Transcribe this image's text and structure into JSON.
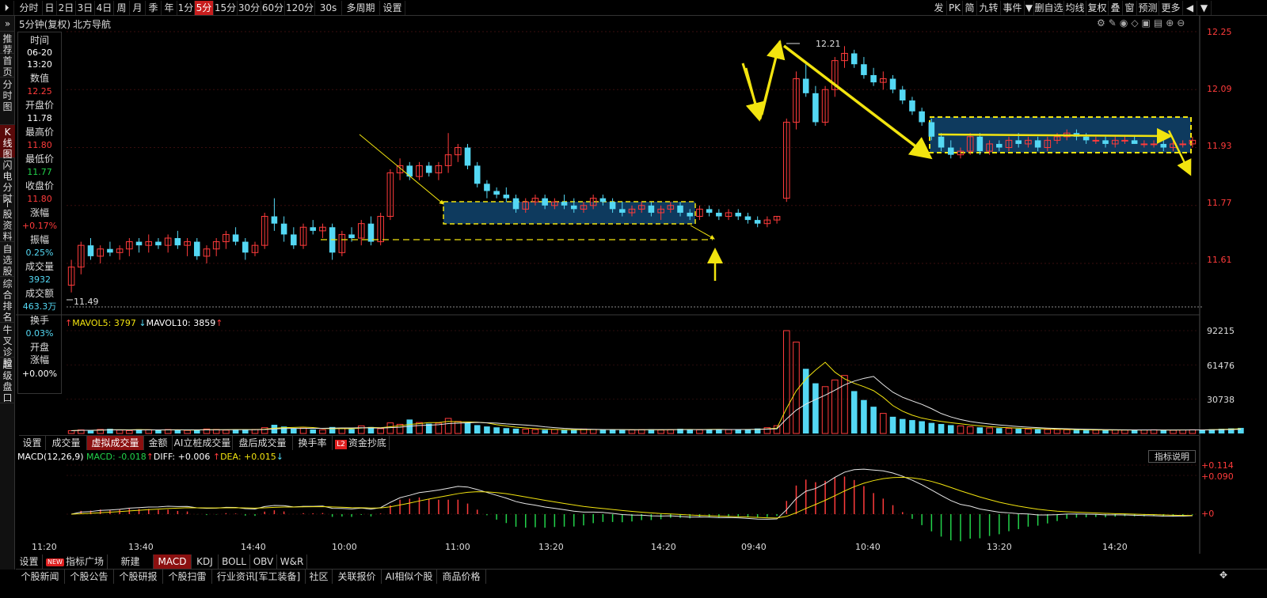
{
  "toolbar": {
    "left": [
      "分时",
      "日",
      "2日",
      "3日",
      "4日",
      "周",
      "月",
      "季",
      "年",
      "1分",
      "5分",
      "15分",
      "30分",
      "60分",
      "120分",
      "30s",
      "多周期",
      "设置"
    ],
    "active": "5分",
    "right": [
      "发",
      "PK",
      "简",
      "九转",
      "事件",
      "▼",
      "删自选",
      "均线",
      "复权",
      "叠",
      "窗",
      "预测",
      "更多",
      "◀",
      "▼"
    ]
  },
  "leftnav": [
    "推荐",
    "首页",
    "分时图",
    "K线图",
    "闪电分时",
    "个股资料",
    "自选股",
    "综合排名",
    "牛叉诊股",
    "超级盘口"
  ],
  "chart_title": "5分钟(复权)",
  "stock_name": "北方导航",
  "info": {
    "time_label": "时间",
    "date": "06-20",
    "time": "13:20",
    "value_label": "数值",
    "value": "12.25",
    "open_label": "开盘价",
    "open": "11.78",
    "high_label": "最高价",
    "high": "11.80",
    "low_label": "最低价",
    "low": "11.77",
    "close_label": "收盘价",
    "close": "11.80",
    "change_label": "涨幅",
    "change": "+0.17%",
    "amplitude_label": "振幅",
    "amplitude": "0.25%",
    "volume_label": "成交量",
    "volume": "3932",
    "amount_label": "成交额",
    "amount": "463.3万",
    "turnover_label": "换手",
    "turnover": "0.03%",
    "open_change_label": "开盘\n涨幅",
    "open_change": "+0.00%"
  },
  "price_axis": [
    "12.25",
    "12.09",
    "11.93",
    "11.77",
    "11.61"
  ],
  "price_marks": {
    "high": "12.21",
    "low": "11.49"
  },
  "volume_axis": [
    "92215",
    "61476",
    "30738"
  ],
  "vol_legend": {
    "mavol5_label": "MAVOL5: ",
    "mavol5": "3797",
    "mavol10_label": "MAVOL10: ",
    "mavol10": "3859"
  },
  "vol_tabs": [
    "设置",
    "成交量",
    "虚拟成交量",
    "金额",
    "AI立桩成交量",
    "盘后成交量",
    "换手率",
    "资金抄底"
  ],
  "vol_tab_active": "虚拟成交量",
  "l2_badge": "L2",
  "macd_legend": {
    "title": "MACD(12,26,9)",
    "macd_label": "MACD: ",
    "macd": "-0.018",
    "diff_label": "DIFF: ",
    "diff": "+0.006",
    "dea_label": "DEA: ",
    "dea": "+0.015"
  },
  "macd_axis": [
    "+0.114",
    "+0.090",
    "+0"
  ],
  "indicator_button": "指标说明",
  "time_axis": [
    "11:20",
    "13:40",
    "14:40",
    "10:00",
    "11:00",
    "13:20",
    "14:20",
    "09:40",
    "10:40",
    "13:20",
    "14:20"
  ],
  "indicator_tabs": [
    "设置",
    "指标广场",
    "新建",
    "MACD",
    "KDJ",
    "BOLL",
    "OBV",
    "W&R"
  ],
  "indicator_tab_active": "MACD",
  "new_badge": "NEW",
  "bottom_tabs": [
    "个股新闻",
    "个股公告",
    "个股研报",
    "个股扫雷",
    "行业资讯[军工装备]",
    "社区",
    "关联报价",
    "AI相似个股",
    "商品价格"
  ],
  "colors": {
    "up": "#ff3b3b",
    "down": "#54d8f4",
    "accent": "#f2e40f",
    "box": "#0e3a5e"
  },
  "chart_data": [
    {
      "type": "candlestick",
      "title": "5分钟(复权) 北方导航",
      "ylim": [
        11.49,
        12.25
      ],
      "y_ticks": [
        12.25,
        12.09,
        11.93,
        11.77,
        11.61
      ],
      "x_ticks": [
        "11:20",
        "13:40",
        "14:40",
        "10:00",
        "11:00",
        "13:20",
        "14:20",
        "09:40",
        "10:40",
        "13:20",
        "14:20"
      ],
      "ohlc": [
        [
          11.55,
          11.62,
          11.53,
          11.6
        ],
        [
          11.6,
          11.67,
          11.58,
          11.66
        ],
        [
          11.66,
          11.68,
          11.62,
          11.63
        ],
        [
          11.63,
          11.66,
          11.61,
          11.65
        ],
        [
          11.65,
          11.67,
          11.63,
          11.64
        ],
        [
          11.64,
          11.66,
          11.62,
          11.65
        ],
        [
          11.65,
          11.68,
          11.63,
          11.67
        ],
        [
          11.67,
          11.68,
          11.64,
          11.66
        ],
        [
          11.66,
          11.69,
          11.64,
          11.67
        ],
        [
          11.67,
          11.68,
          11.65,
          11.66
        ],
        [
          11.66,
          11.69,
          11.64,
          11.68
        ],
        [
          11.68,
          11.7,
          11.65,
          11.66
        ],
        [
          11.66,
          11.68,
          11.63,
          11.67
        ],
        [
          11.67,
          11.68,
          11.62,
          11.63
        ],
        [
          11.63,
          11.66,
          11.61,
          11.65
        ],
        [
          11.65,
          11.68,
          11.63,
          11.67
        ],
        [
          11.67,
          11.7,
          11.65,
          11.69
        ],
        [
          11.69,
          11.71,
          11.66,
          11.67
        ],
        [
          11.67,
          11.68,
          11.62,
          11.64
        ],
        [
          11.64,
          11.67,
          11.63,
          11.66
        ],
        [
          11.66,
          11.75,
          11.65,
          11.74
        ],
        [
          11.74,
          11.79,
          11.7,
          11.72
        ],
        [
          11.72,
          11.74,
          11.67,
          11.69
        ],
        [
          11.69,
          11.71,
          11.65,
          11.66
        ],
        [
          11.66,
          11.72,
          11.65,
          11.71
        ],
        [
          11.71,
          11.73,
          11.69,
          11.7
        ],
        [
          11.7,
          11.72,
          11.68,
          11.71
        ],
        [
          11.71,
          11.72,
          11.62,
          11.64
        ],
        [
          11.64,
          11.7,
          11.63,
          11.69
        ],
        [
          11.69,
          11.71,
          11.67,
          11.68
        ],
        [
          11.68,
          11.73,
          11.66,
          11.72
        ],
        [
          11.72,
          11.74,
          11.66,
          11.67
        ],
        [
          11.67,
          11.75,
          11.66,
          11.74
        ],
        [
          11.74,
          11.87,
          11.73,
          11.86
        ],
        [
          11.86,
          11.9,
          11.84,
          11.88
        ],
        [
          11.88,
          11.89,
          11.84,
          11.85
        ],
        [
          11.85,
          11.89,
          11.84,
          11.88
        ],
        [
          11.88,
          11.89,
          11.85,
          11.86
        ],
        [
          11.86,
          11.89,
          11.84,
          11.88
        ],
        [
          11.88,
          11.97,
          11.86,
          11.91
        ],
        [
          11.91,
          11.94,
          11.89,
          11.93
        ],
        [
          11.93,
          11.94,
          11.87,
          11.88
        ],
        [
          11.88,
          11.89,
          11.82,
          11.83
        ],
        [
          11.83,
          11.84,
          11.79,
          11.81
        ],
        [
          11.81,
          11.82,
          11.79,
          11.8
        ],
        [
          11.8,
          11.82,
          11.78,
          11.79
        ],
        [
          11.79,
          11.8,
          11.75,
          11.76
        ],
        [
          11.76,
          11.79,
          11.75,
          11.78
        ],
        [
          11.78,
          11.8,
          11.77,
          11.79
        ],
        [
          11.79,
          11.8,
          11.76,
          11.77
        ],
        [
          11.77,
          11.79,
          11.76,
          11.78
        ],
        [
          11.78,
          11.8,
          11.76,
          11.77
        ],
        [
          11.77,
          11.79,
          11.75,
          11.76
        ],
        [
          11.76,
          11.78,
          11.75,
          11.77
        ],
        [
          11.77,
          11.8,
          11.76,
          11.79
        ],
        [
          11.79,
          11.8,
          11.77,
          11.78
        ],
        [
          11.78,
          11.79,
          11.75,
          11.76
        ],
        [
          11.76,
          11.78,
          11.74,
          11.75
        ],
        [
          11.75,
          11.77,
          11.74,
          11.76
        ],
        [
          11.76,
          11.78,
          11.75,
          11.77
        ],
        [
          11.77,
          11.78,
          11.74,
          11.75
        ],
        [
          11.75,
          11.77,
          11.73,
          11.76
        ],
        [
          11.76,
          11.78,
          11.75,
          11.77
        ],
        [
          11.77,
          11.78,
          11.74,
          11.75
        ],
        [
          11.75,
          11.76,
          11.73,
          11.74
        ],
        [
          11.74,
          11.77,
          11.73,
          11.76
        ],
        [
          11.76,
          11.77,
          11.74,
          11.75
        ],
        [
          11.75,
          11.76,
          11.73,
          11.74
        ],
        [
          11.74,
          11.76,
          11.73,
          11.75
        ],
        [
          11.75,
          11.76,
          11.73,
          11.74
        ],
        [
          11.74,
          11.75,
          11.72,
          11.73
        ],
        [
          11.73,
          11.74,
          11.71,
          11.72
        ],
        [
          11.72,
          11.74,
          11.71,
          11.73
        ],
        [
          11.73,
          11.74,
          11.72,
          11.74
        ],
        [
          11.79,
          12.01,
          11.78,
          12.0
        ],
        [
          12.0,
          12.14,
          11.98,
          12.12
        ],
        [
          12.12,
          12.16,
          12.07,
          12.08
        ],
        [
          12.08,
          12.1,
          11.99,
          12.0
        ],
        [
          12.0,
          12.1,
          11.99,
          12.09
        ],
        [
          12.09,
          12.18,
          12.07,
          12.17
        ],
        [
          12.17,
          12.21,
          12.15,
          12.19
        ],
        [
          12.19,
          12.2,
          12.15,
          12.16
        ],
        [
          12.16,
          12.18,
          12.12,
          12.13
        ],
        [
          12.13,
          12.15,
          12.1,
          12.11
        ],
        [
          12.11,
          12.14,
          12.09,
          12.12
        ],
        [
          12.12,
          12.13,
          12.08,
          12.09
        ],
        [
          12.09,
          12.1,
          12.05,
          12.06
        ],
        [
          12.06,
          12.07,
          12.02,
          12.03
        ],
        [
          12.03,
          12.04,
          11.99,
          12.0
        ],
        [
          12.0,
          12.01,
          11.95,
          11.96
        ],
        [
          11.96,
          11.97,
          11.92,
          11.93
        ],
        [
          11.93,
          11.95,
          11.9,
          11.91
        ],
        [
          11.91,
          11.93,
          11.9,
          11.92
        ],
        [
          11.92,
          11.97,
          11.91,
          11.96
        ],
        [
          11.96,
          11.97,
          11.91,
          11.92
        ],
        [
          11.92,
          11.95,
          11.91,
          11.94
        ],
        [
          11.94,
          11.95,
          11.92,
          11.93
        ],
        [
          11.93,
          11.96,
          11.92,
          11.95
        ],
        [
          11.95,
          11.97,
          11.93,
          11.94
        ],
        [
          11.94,
          11.96,
          11.93,
          11.95
        ],
        [
          11.95,
          11.96,
          11.92,
          11.93
        ],
        [
          11.93,
          11.96,
          11.92,
          11.95
        ],
        [
          11.95,
          11.97,
          11.94,
          11.96
        ],
        [
          11.96,
          11.98,
          11.95,
          11.97
        ],
        [
          11.97,
          11.98,
          11.95,
          11.96
        ],
        [
          11.96,
          11.97,
          11.94,
          11.95
        ],
        [
          11.95,
          11.96,
          11.94,
          11.95
        ],
        [
          11.95,
          11.96,
          11.93,
          11.94
        ],
        [
          11.94,
          11.96,
          11.93,
          11.95
        ],
        [
          11.95,
          11.96,
          11.94,
          11.95
        ],
        [
          11.95,
          11.96,
          11.94,
          11.94
        ],
        [
          11.94,
          11.95,
          11.93,
          11.94
        ],
        [
          11.94,
          11.95,
          11.93,
          11.94
        ],
        [
          11.94,
          11.95,
          11.92,
          11.93
        ],
        [
          11.93,
          11.95,
          11.92,
          11.94
        ],
        [
          11.94,
          11.95,
          11.93,
          11.94
        ],
        [
          11.94,
          11.96,
          11.93,
          11.95
        ]
      ]
    },
    {
      "type": "bar",
      "title": "虚拟成交量",
      "ylim": [
        0,
        92215
      ],
      "y_ticks": [
        92215,
        61476,
        30738
      ],
      "series": [
        {
          "name": "MAVOL5",
          "value": 3797
        },
        {
          "name": "MAVOL10",
          "value": 3859
        }
      ],
      "values": [
        2500,
        3200,
        2800,
        3600,
        4200,
        3000,
        2600,
        3800,
        3300,
        2900,
        3500,
        3100,
        2800,
        3400,
        4000,
        3600,
        3000,
        3800,
        3300,
        3600,
        5200,
        7800,
        6200,
        4400,
        4800,
        3600,
        3300,
        5800,
        4800,
        3900,
        6800,
        5800,
        4300,
        9500,
        8200,
        12500,
        9800,
        8800,
        9300,
        13500,
        10800,
        9500,
        7500,
        6300,
        5500,
        4800,
        4300,
        3800,
        3500,
        3300,
        3600,
        3100,
        3300,
        4000,
        3600,
        3300,
        3500,
        3100,
        3200,
        3400,
        3800,
        3100,
        3300,
        4200,
        3600,
        3300,
        3800,
        3500,
        3400,
        3600,
        3800,
        4500,
        5200,
        7000,
        92215,
        82000,
        58000,
        45000,
        42000,
        48000,
        52000,
        38000,
        30000,
        24000,
        18000,
        15000,
        13000,
        12000,
        11000,
        9500,
        8500,
        7500,
        6800,
        6000,
        5500,
        5000,
        4800,
        4500,
        4300,
        4000,
        3800,
        3600,
        3500,
        3300,
        3200,
        3100,
        3000,
        3100,
        3200,
        3100,
        3000,
        3200,
        3300,
        3100,
        3000,
        3200,
        3300,
        3500,
        3800,
        4200,
        4600,
        5000
      ]
    },
    {
      "type": "bar",
      "title": "MACD(12,26,9)",
      "series": [
        {
          "name": "MACD",
          "value": -0.018
        },
        {
          "name": "DIFF",
          "value": 0.006
        },
        {
          "name": "DEA",
          "value": 0.015
        }
      ],
      "y_ticks": [
        0.114,
        0.09,
        0
      ]
    }
  ]
}
